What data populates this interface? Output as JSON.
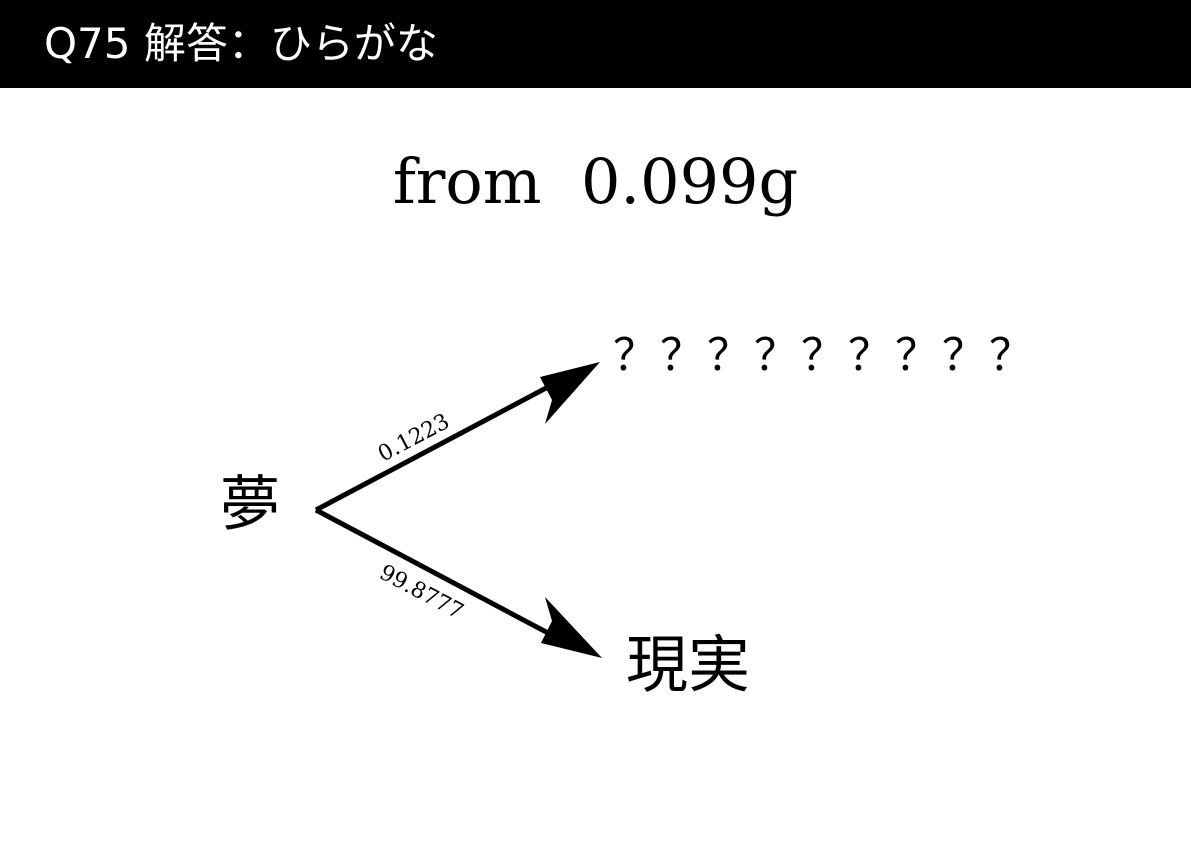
{
  "header": {
    "title": "Q75  解答：ひらがな"
  },
  "main": {
    "subtitle": "from  0.099g"
  },
  "diagram": {
    "source_node": "夢",
    "target_upper": "？？？？？？？？？",
    "target_lower": "現実",
    "edge_upper_label": "0.1223",
    "edge_lower_label": "99.8777"
  },
  "colors": {
    "header_bg": "#000000",
    "header_text": "#ffffff",
    "ink": "#000000",
    "page_bg": "#ffffff"
  }
}
